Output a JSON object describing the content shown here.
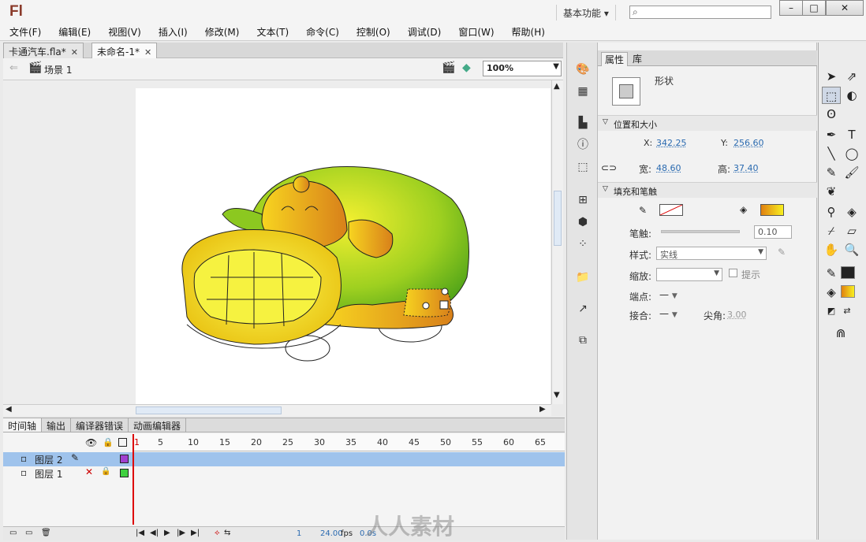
{
  "app": {
    "logo": "Fl",
    "workspace": "基本功能",
    "search_icon": "⌕"
  },
  "window_buttons": {
    "minimize": "–",
    "maximize": "□",
    "close": "✕"
  },
  "menu": [
    "文件(F)",
    "编辑(E)",
    "视图(V)",
    "插入(I)",
    "修改(M)",
    "文本(T)",
    "命令(C)",
    "控制(O)",
    "调试(D)",
    "窗口(W)",
    "帮助(H)"
  ],
  "doc_tabs": [
    {
      "label": "卡通汽车.fla*",
      "active": false
    },
    {
      "label": "未命名-1*",
      "active": true
    }
  ],
  "scene": {
    "label": "场景 1",
    "zoom": "100%"
  },
  "timeline": {
    "tabs": [
      "时间轴",
      "输出",
      "编译器错误",
      "动画编辑器"
    ],
    "ruler": [
      "1",
      "5",
      "10",
      "15",
      "20",
      "25",
      "30",
      "35",
      "40",
      "45",
      "50",
      "55",
      "60",
      "65"
    ],
    "layers": [
      {
        "name": "图层 2",
        "selected": true,
        "color": "#a040d0"
      },
      {
        "name": "图层 1",
        "selected": false,
        "color": "#40d040"
      }
    ],
    "status": {
      "frame": "1",
      "fps": "24.00",
      "fps_unit": "fps",
      "time": "0.0s"
    }
  },
  "properties": {
    "tabs": [
      "属性",
      "库"
    ],
    "type_label": "形状",
    "section_position": "位置和大小",
    "x_label": "X:",
    "x_value": "342.25",
    "y_label": "Y:",
    "y_value": "256.60",
    "w_label": "宽:",
    "w_value": "48.60",
    "h_label": "高:",
    "h_value": "37.40",
    "section_fill": "填充和笔触",
    "stroke_label": "笔触:",
    "stroke_value": "0.10",
    "style_label": "样式:",
    "style_value": "实线",
    "scale_label": "缩放:",
    "scale_value": "",
    "hint_label": "提示",
    "cap_label": "端点:",
    "cap_value": "—",
    "join_label": "接合:",
    "join_value": "—",
    "miter_label": "尖角:",
    "miter_value": "3.00"
  },
  "watermark": "人人素材",
  "colors": {
    "accent_selected": "#9fc3ec",
    "fill_gradient_start": "#e08010",
    "fill_gradient_end": "#f8f020",
    "stroke_color": "#222222"
  }
}
